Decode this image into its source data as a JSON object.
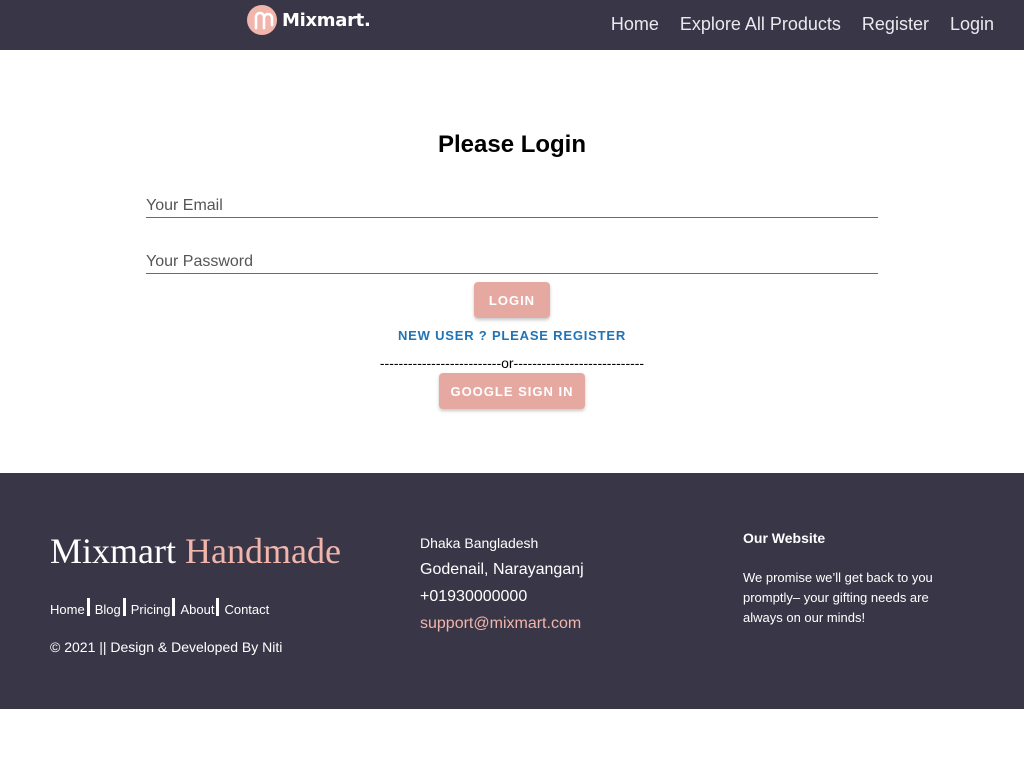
{
  "navbar": {
    "brand_text": "Mixmart.",
    "logo_icon": "mixmart-logo-icon",
    "links": [
      {
        "label": "Home"
      },
      {
        "label": "Explore All Products"
      },
      {
        "label": "Register"
      },
      {
        "label": "Login"
      }
    ]
  },
  "login": {
    "title": "Please Login",
    "email_placeholder": "Your Email",
    "password_placeholder": "Your Password",
    "login_button": "Login",
    "register_link": "New User ? Please Register",
    "divider": "--------------------------or----------------------------",
    "google_button": "Google Sign In"
  },
  "footer": {
    "brand_main": "Mixmart",
    "brand_accent": "Handmade",
    "nav": [
      "Home",
      "Blog",
      "Pricing",
      "About",
      "Contact"
    ],
    "copyright": "© 2021 || Design & Developed By Niti",
    "address": {
      "city": "Dhaka Bangladesh",
      "area": "Godenail, Narayanganj",
      "phone": "+01930000000",
      "email": "support@mixmart.com"
    },
    "website": {
      "title": "Our Website",
      "description": "We promise we’ll get back to you promptly– your gifting needs are always on our minds!"
    }
  },
  "colors": {
    "navbar_bg": "#393747",
    "accent": "#f1b5ab",
    "button_bg": "#e6a9a2",
    "link_blue": "#1f73b7"
  }
}
